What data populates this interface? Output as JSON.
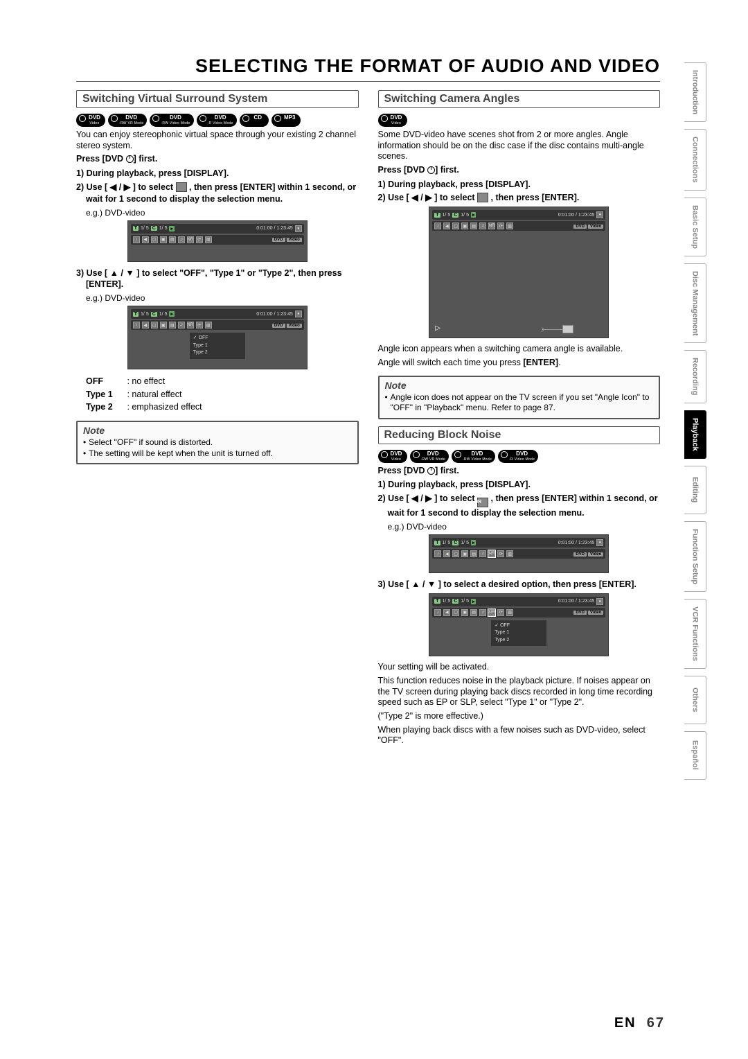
{
  "title": "SELECTING THE FORMAT OF AUDIO AND VIDEO",
  "footer": {
    "lang": "EN",
    "page": "67"
  },
  "side_tabs": [
    "Introduction",
    "Connections",
    "Basic Setup",
    "Disc Management",
    "Recording",
    "Playback",
    "Editing",
    "Function Setup",
    "VCR Functions",
    "Others",
    "Español"
  ],
  "side_active_index": 5,
  "surround": {
    "heading": "Switching Virtual Surround System",
    "badges": [
      {
        "t": "DVD",
        "s": "Video"
      },
      {
        "t": "DVD",
        "s": "-RW VR Mode"
      },
      {
        "t": "DVD",
        "s": "-RW Video Mode"
      },
      {
        "t": "DVD",
        "s": "-R Video Mode"
      },
      {
        "t": "CD",
        "s": ""
      },
      {
        "t": "MP3",
        "s": ""
      }
    ],
    "intro": "You can enjoy stereophonic virtual space through your existing 2 channel stereo system.",
    "press_first": "Press [DVD ⏻] first.",
    "step1": "1) During playback, press [DISPLAY].",
    "step2a": "2) Use [ ◀ / ▶ ] to select ",
    "step2b": " , then press [ENTER] within 1 second, or wait for 1 second to display the selection menu.",
    "eg1": "e.g.) DVD-video",
    "step3": "3) Use [ ▲ / ▼ ] to select \"OFF\", \"Type 1\" or \"Type 2\", then press [ENTER].",
    "eg2": "e.g.) DVD-video",
    "defs": [
      {
        "k": "OFF",
        "v": ": no effect"
      },
      {
        "k": "Type 1",
        "v": ": natural effect"
      },
      {
        "k": "Type 2",
        "v": ": emphasized effect"
      }
    ],
    "note_h": "Note",
    "notes": [
      "Select \"OFF\" if sound is distorted.",
      "The setting will be kept when the unit is turned off."
    ]
  },
  "angles": {
    "heading": "Switching Camera Angles",
    "badges": [
      {
        "t": "DVD",
        "s": "Video"
      }
    ],
    "intro": "Some DVD-video have scenes shot from 2 or more angles. Angle information should be on the disc case if the disc contains multi-angle scenes.",
    "press_first": "Press [DVD ⏻] first.",
    "step1": "1) During playback, press [DISPLAY].",
    "step2": "2) Use [ ◀ / ▶ ] to select  , then press [ENTER].",
    "after1": "Angle icon appears when a switching camera angle is available.",
    "after2": "Angle will switch each time you press [ENTER].",
    "note_h": "Note",
    "notes": [
      "Angle icon does not appear on the TV screen if you set \"Angle Icon\" to \"OFF\" in \"Playback\" menu. Refer to page 87."
    ]
  },
  "noise": {
    "heading": "Reducing Block Noise",
    "badges": [
      {
        "t": "DVD",
        "s": "Video"
      },
      {
        "t": "DVD",
        "s": "-RW VR Mode"
      },
      {
        "t": "DVD",
        "s": "-RW Video Mode"
      },
      {
        "t": "DVD",
        "s": "-R Video Mode"
      }
    ],
    "press_first": "Press [DVD ⏻] first.",
    "step1": "1) During playback, press [DISPLAY].",
    "step2a": "2) Use [ ◀ / ▶ ] to select ",
    "step2_icon": "NR",
    "step2b": " , then press [ENTER] within 1 second, or wait for 1 second to display the selection menu.",
    "eg1": "e.g.) DVD-video",
    "step3": "3) Use [ ▲ / ▼ ] to select a desired option, then press [ENTER].",
    "after1": "Your setting will be activated.",
    "after2": "This function reduces noise in the playback picture. If noises appear on the TV screen during playing back discs recorded in long time recording speed such as EP or SLP, select \"Type 1\" or \"Type 2\".",
    "after3": "(\"Type 2\" is more effective.)",
    "after4": "When playing back discs with a few noises such as DVD-video, select \"OFF\"."
  },
  "osd": {
    "counter": "1/  5",
    "chap": "1/  5",
    "time": "0:01:00 / 1:23:45",
    "mode1": "DVD",
    "mode2": "Video",
    "menu_off": "OFF",
    "menu_t1": "Type 1",
    "menu_t2": "Type 2"
  }
}
